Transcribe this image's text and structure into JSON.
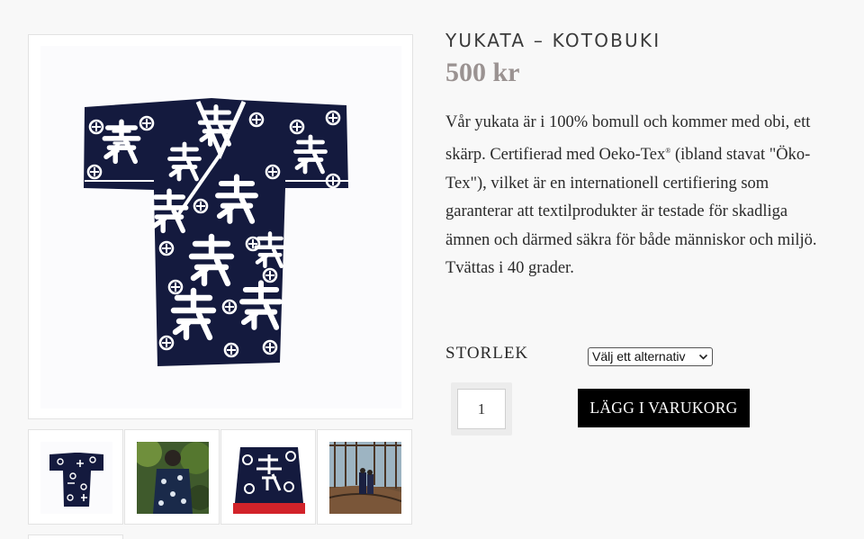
{
  "product": {
    "title": "YUKATA – KOTOBUKI",
    "price": "500 kr",
    "description_part1": "Vår yukata är i 100% bomull och kommer med obi, ett skärp. Certifierad med Oeko-Tex",
    "description_sup": "®",
    "description_part2": " (ibland stavat \"Öko-Tex\"), vilket  är en internationell certifiering som garanterar att textilprodukter är testade för skadliga ämnen och därmed säkra för både människor och miljö. Tvättas i 40 grader."
  },
  "variation": {
    "label": "STORLEK",
    "select_value": "Välj ett alternativ"
  },
  "cart": {
    "quantity": "1",
    "add_button": "LÄGG I VARUKORG"
  },
  "gallery": {
    "main_image": "yukata-kotobuki-front",
    "thumbnails": [
      "yukata-flat",
      "yukata-back-garden",
      "yukata-back-detail",
      "yukata-terrace"
    ]
  },
  "colors": {
    "indigo": "#141a3e",
    "price": "#9a9291",
    "button": "#000000"
  }
}
